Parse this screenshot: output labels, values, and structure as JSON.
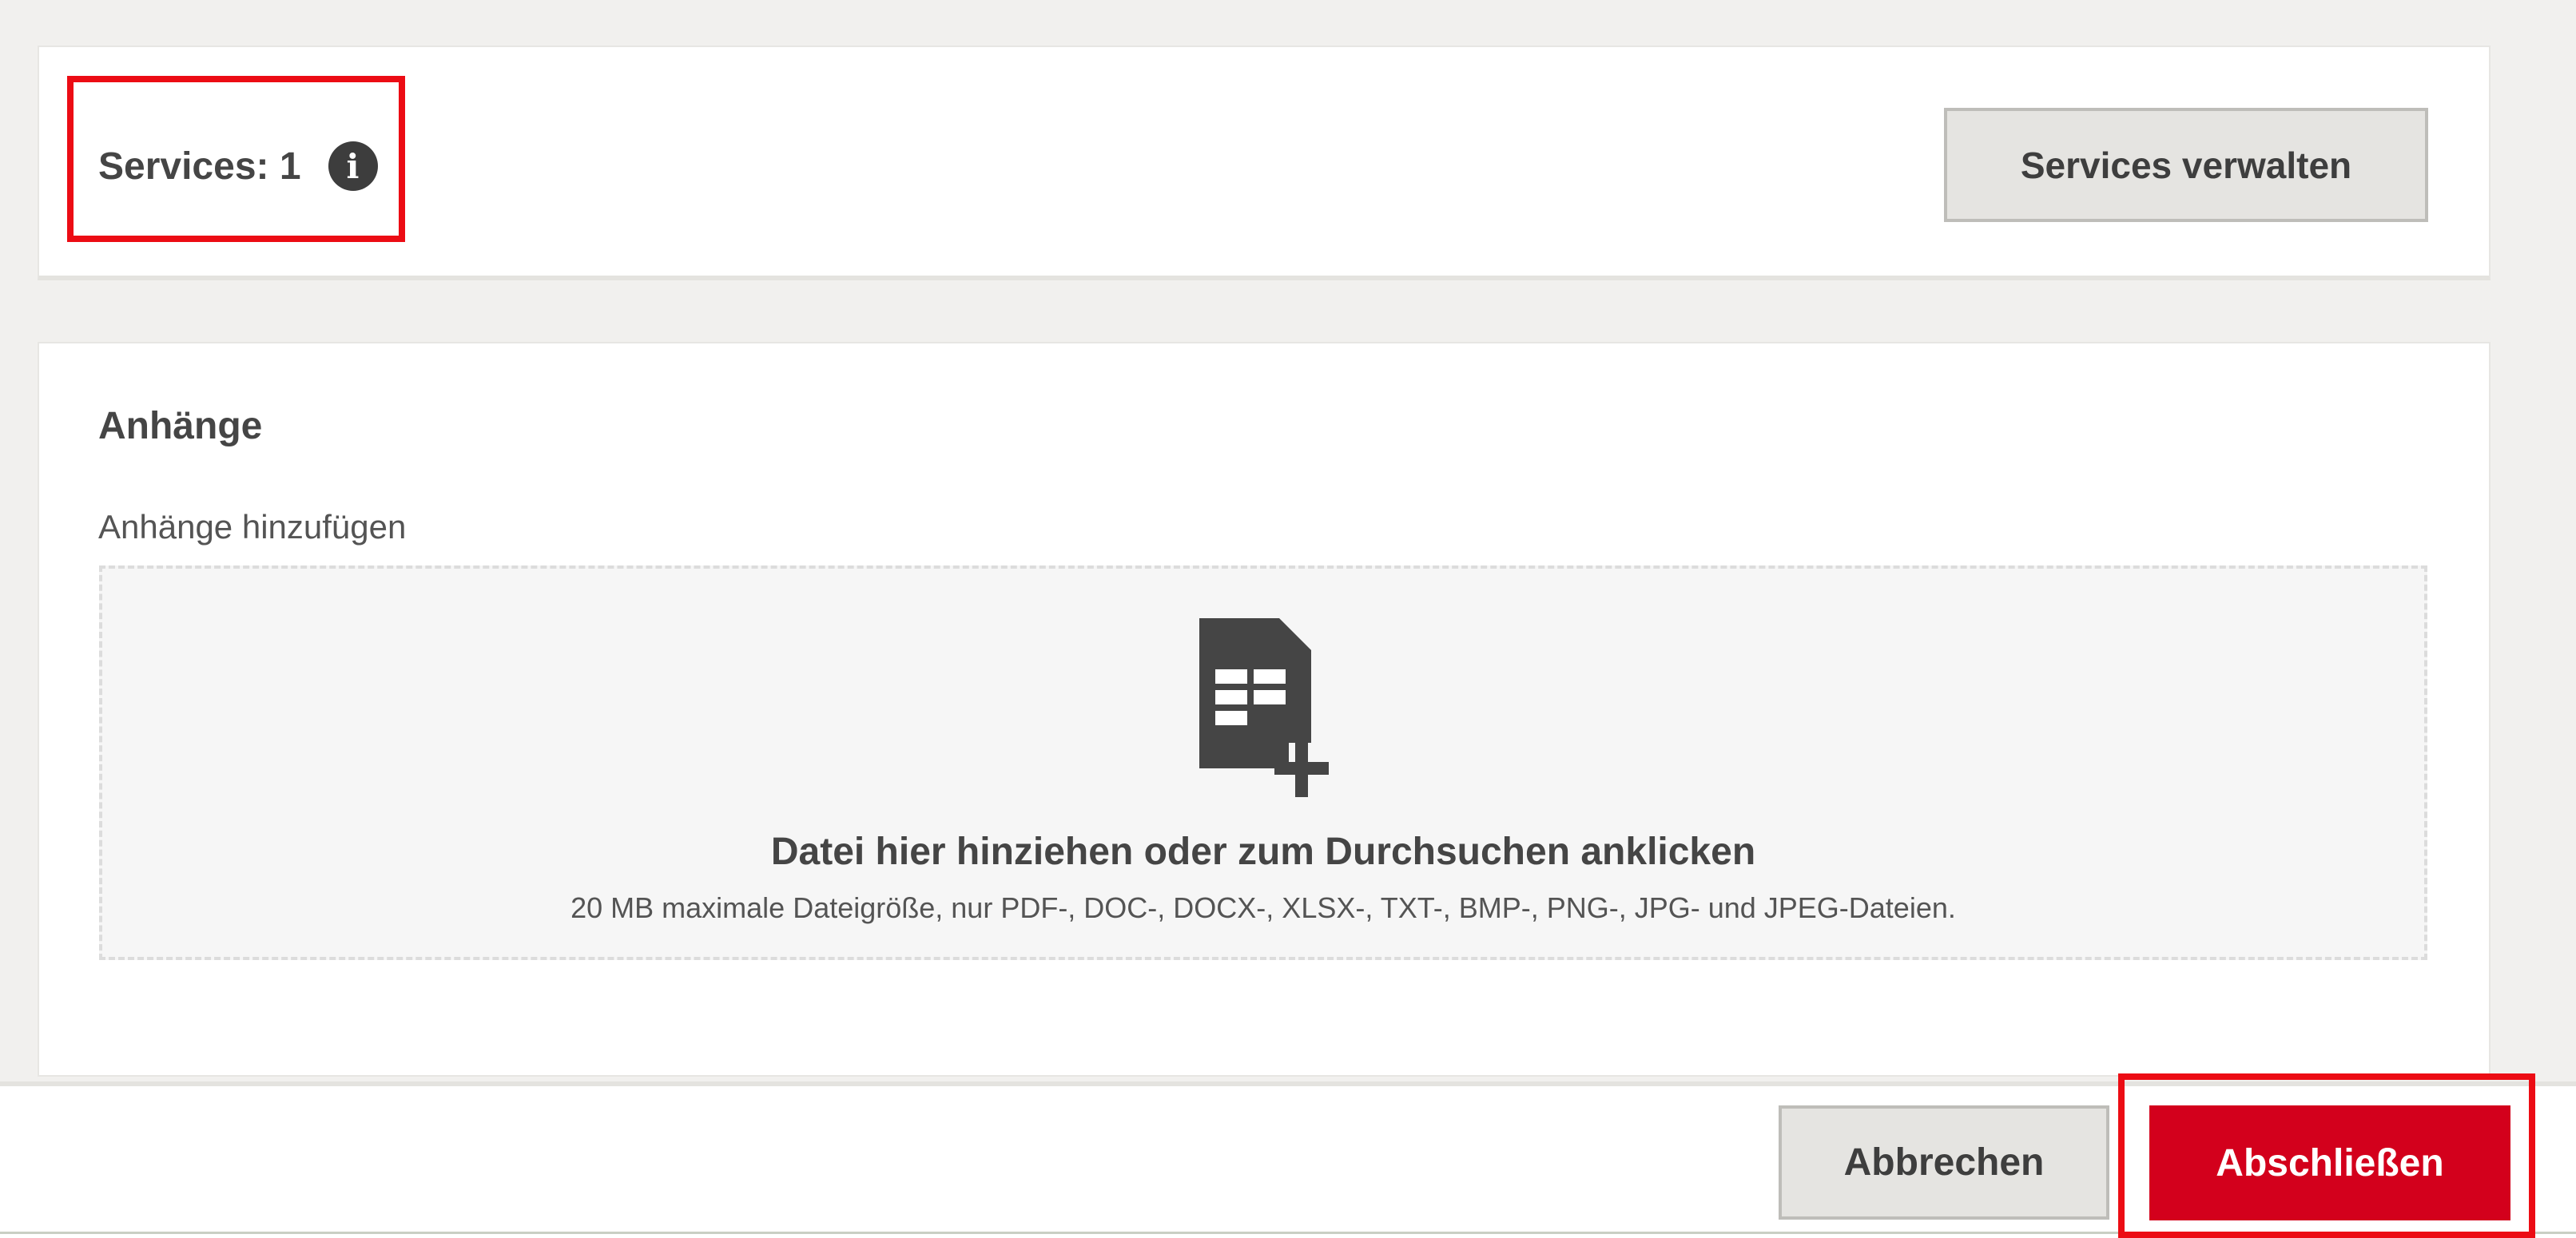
{
  "services": {
    "count_label": "Services: 1",
    "info_icon": "info-icon",
    "manage_button_label": "Services verwalten"
  },
  "attachments": {
    "title": "Anhänge",
    "add_label": "Anhänge hinzufügen",
    "dropzone": {
      "icon": "file-add-icon",
      "title": "Datei hier hinziehen oder zum Durchsuchen anklicken",
      "hint": "20 MB maximale Dateigröße, nur PDF-, DOC-, DOCX-, XLSX-, TXT-, BMP-, PNG-, JPG- und JPEG-Dateien."
    }
  },
  "footer": {
    "cancel_label": "Abbrechen",
    "finish_label": "Abschließen"
  },
  "colors": {
    "background": "#f1f0ee",
    "card": "#ffffff",
    "primary_button": "#d3001c",
    "secondary_button": "#e5e4e1",
    "highlight": "#ec0c14",
    "text": "#454545"
  }
}
